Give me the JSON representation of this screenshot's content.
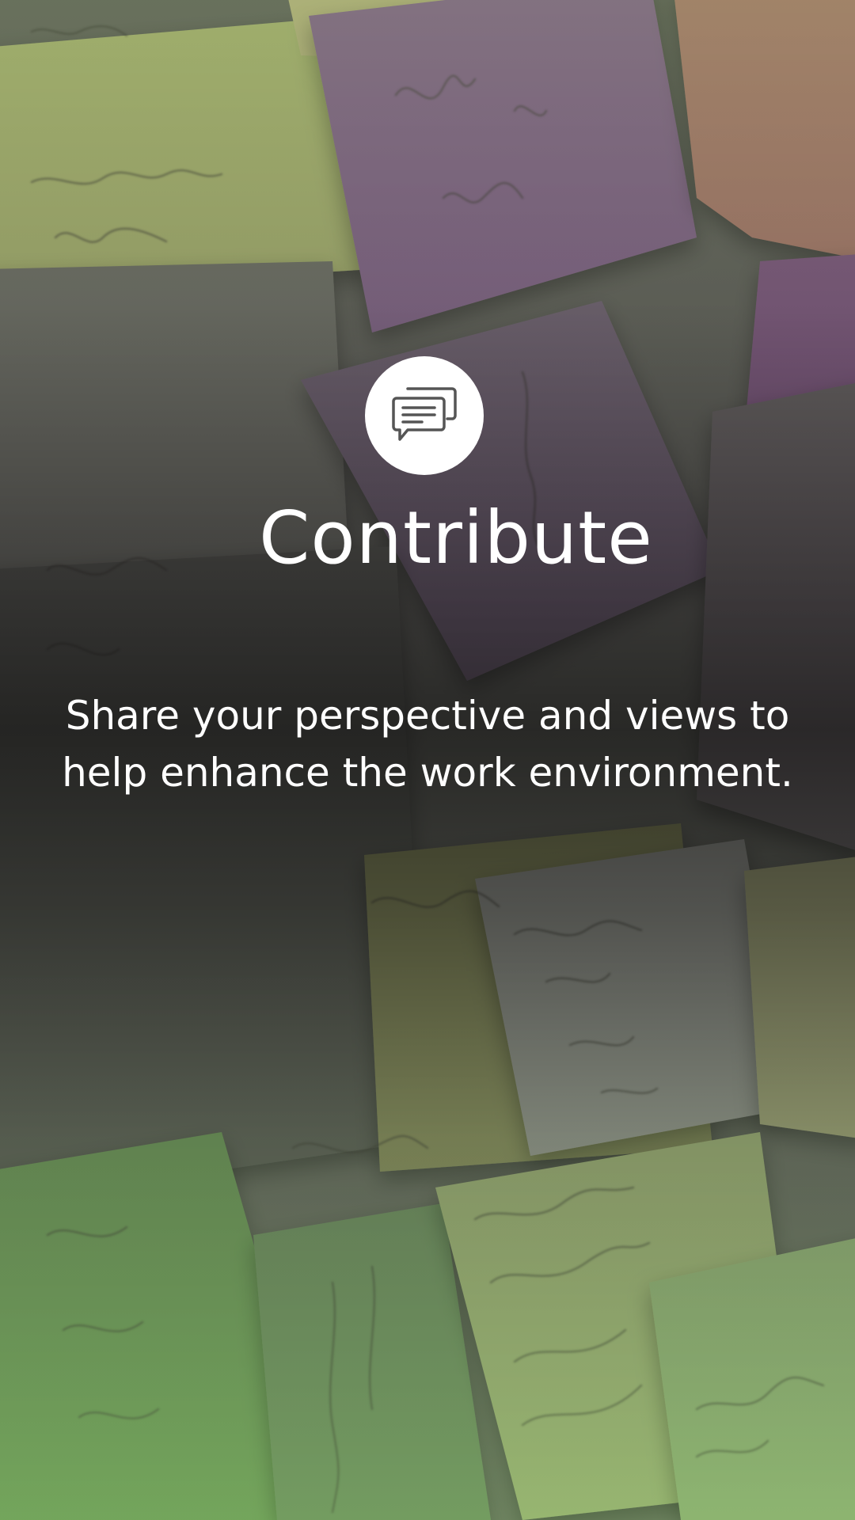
{
  "screen": {
    "icon": "chat-bubbles-icon",
    "title": "Contribute",
    "subtitle": "Share your perspective and views to help enhance the work environment."
  },
  "colors": {
    "title_text": "#ffffff",
    "icon_circle": "#ffffff",
    "icon_stroke": "#555555"
  },
  "background_image": {
    "note_colors": [
      "#cfd98f",
      "#a97bb0",
      "#d99a88",
      "#8fbf6f",
      "#b9b9b9",
      "#9a6fa3"
    ]
  }
}
